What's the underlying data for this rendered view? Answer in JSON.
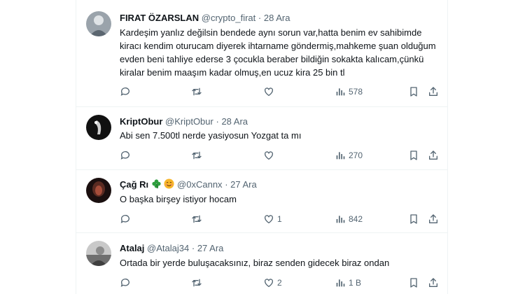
{
  "tweets": [
    {
      "name": "FIRAT ÖZARSLAN",
      "handle": "@crypto_firat",
      "sep": "·",
      "date": "28 Ara",
      "text": "Kardeşim yanlız değilsin bendede aynı sorun var,hatta benim ev sahibimde kiracı kendim oturucam diyerek ihtarname göndermiş,mahkeme şuan olduğum evden beni tahliye ederse 3 çocukla beraber  bildiğin sokakta kalıcam,çünkü kiralar benim maaşım kadar olmuş,en ucuz kira 25 bin tl",
      "replies": "",
      "retweets": "",
      "likes": "",
      "views": "578"
    },
    {
      "name": "KriptObur",
      "handle": "@KriptObur",
      "sep": "·",
      "date": "28 Ara",
      "text": "Abi sen 7.500tl nerde yasiyosun Yozgat ta mı",
      "replies": "",
      "retweets": "",
      "likes": "",
      "views": "270"
    },
    {
      "name": "Çağ Rı",
      "name_emojis": [
        "clover-icon",
        "smiling-face-icon"
      ],
      "handle": "@0xCannx",
      "sep": "·",
      "date": "27 Ara",
      "text": "O başka birşey istiyor hocam",
      "replies": "",
      "retweets": "",
      "likes": "1",
      "views": "842"
    },
    {
      "name": "Atalaj",
      "handle": "@Atalaj34",
      "sep": "·",
      "date": "27 Ara",
      "text": "Ortada bir yerde buluşacaksınız, biraz senden gidecek biraz ondan",
      "replies": "",
      "retweets": "",
      "likes": "2",
      "views": "1 B"
    }
  ],
  "colors": {
    "text": "#0f1419",
    "muted": "#536471",
    "divider": "#eff3f4",
    "clover": "#2e9e3e",
    "smiley": "#f7b529"
  }
}
